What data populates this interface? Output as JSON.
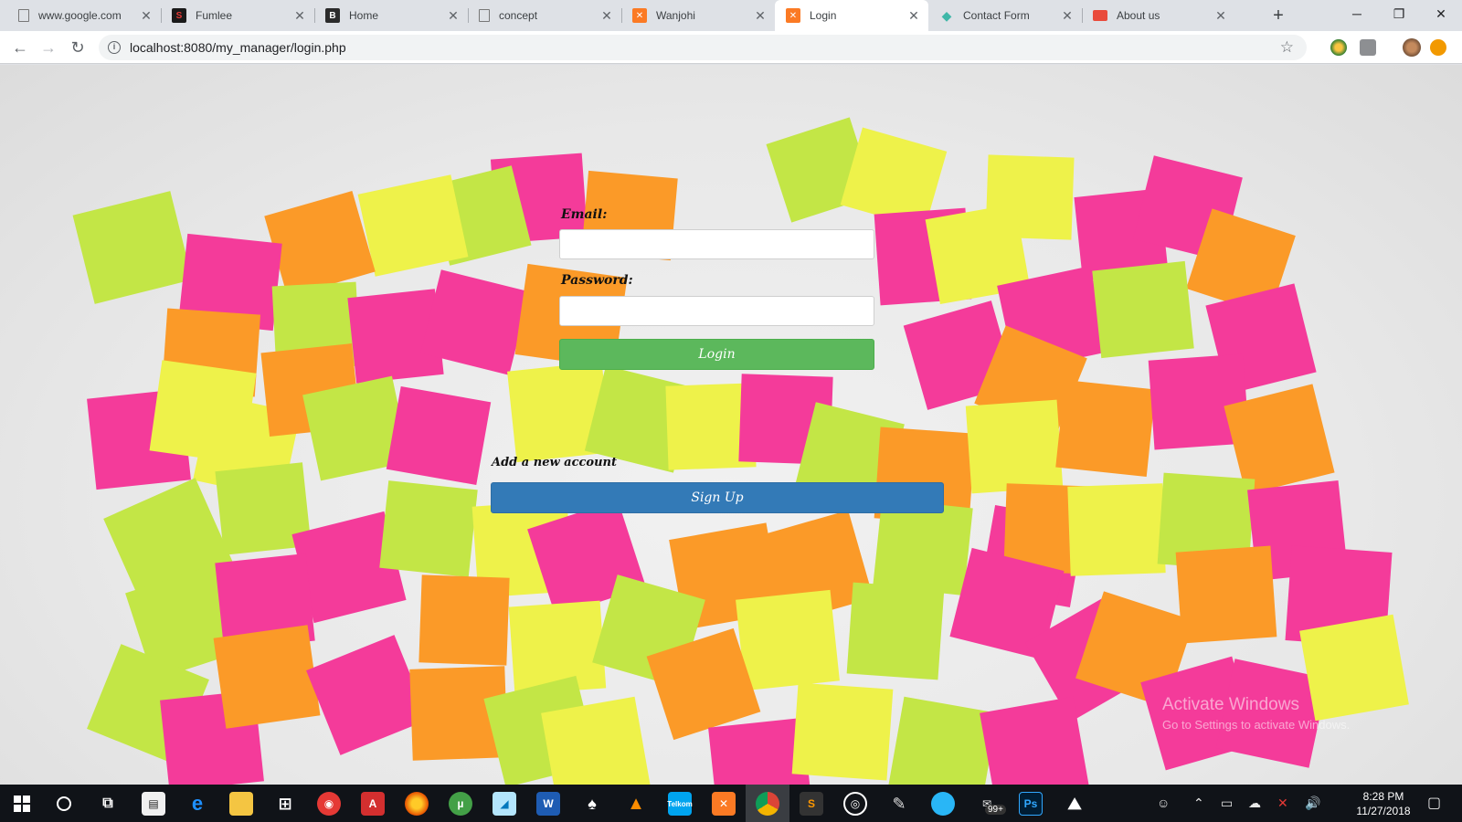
{
  "browser": {
    "tabs": [
      {
        "title": "www.google.com",
        "icon": "page-icon",
        "active": false
      },
      {
        "title": "Fumlee",
        "icon": "fumlee-logo-icon",
        "active": false
      },
      {
        "title": "Home",
        "icon": "b-logo-icon",
        "active": false
      },
      {
        "title": "concept",
        "icon": "page-icon",
        "active": false
      },
      {
        "title": "Wanjohi",
        "icon": "xampp-icon",
        "active": false
      },
      {
        "title": "Login",
        "icon": "xampp-icon",
        "active": true
      },
      {
        "title": "Contact Form",
        "icon": "diamond-icon",
        "active": false
      },
      {
        "title": "About us",
        "icon": "red-square-icon",
        "active": false
      }
    ],
    "url": "localhost:8080/my_manager/login.php"
  },
  "login_form": {
    "email_label": "Email:",
    "email_value": "",
    "password_label": "Password:",
    "password_value": "",
    "login_button": "Login",
    "signup_prompt": "Add a new account",
    "signup_button": "Sign Up"
  },
  "watermark": {
    "title": "Activate Windows",
    "subtitle": "Go to Settings to activate Windows."
  },
  "taskbar": {
    "time": "8:28 PM",
    "date": "11/27/2018",
    "notification_badge": "99+"
  },
  "colors": {
    "login_button": "#5cb85c",
    "signup_button": "#337ab7",
    "note_pink": "#f43b9a",
    "note_yellow": "#eef24a",
    "note_orange": "#fb9a28",
    "note_green": "#c3e646"
  }
}
